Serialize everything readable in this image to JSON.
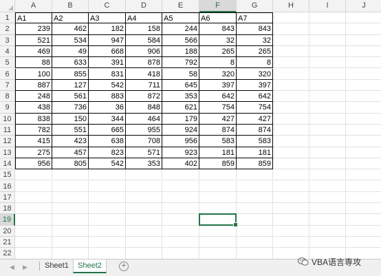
{
  "columns": [
    "A",
    "B",
    "C",
    "D",
    "E",
    "F",
    "G",
    "H",
    "I",
    "J"
  ],
  "rows": [
    "1",
    "2",
    "3",
    "4",
    "5",
    "6",
    "7",
    "8",
    "9",
    "10",
    "11",
    "12",
    "13",
    "14",
    "15",
    "16",
    "17",
    "18",
    "19",
    "20",
    "21",
    "22"
  ],
  "selected": {
    "column": "F",
    "row": "19"
  },
  "table": {
    "headers": [
      "A1",
      "A2",
      "A3",
      "A4",
      "A5",
      "A6",
      "A7"
    ],
    "data": [
      [
        "239",
        "462",
        "182",
        "158",
        "244",
        "843",
        "843"
      ],
      [
        "521",
        "534",
        "947",
        "584",
        "566",
        "32",
        "32"
      ],
      [
        "469",
        "49",
        "668",
        "906",
        "188",
        "265",
        "265"
      ],
      [
        "88",
        "633",
        "391",
        "878",
        "792",
        "8",
        "8"
      ],
      [
        "100",
        "855",
        "831",
        "418",
        "58",
        "320",
        "320"
      ],
      [
        "887",
        "127",
        "542",
        "711",
        "645",
        "397",
        "397"
      ],
      [
        "248",
        "561",
        "883",
        "872",
        "353",
        "642",
        "642"
      ],
      [
        "438",
        "736",
        "36",
        "848",
        "621",
        "754",
        "754"
      ],
      [
        "838",
        "150",
        "344",
        "464",
        "179",
        "427",
        "427"
      ],
      [
        "782",
        "551",
        "665",
        "955",
        "924",
        "874",
        "874"
      ],
      [
        "415",
        "423",
        "638",
        "708",
        "956",
        "583",
        "583"
      ],
      [
        "275",
        "457",
        "823",
        "571",
        "923",
        "181",
        "181"
      ],
      [
        "956",
        "805",
        "542",
        "353",
        "402",
        "859",
        "859"
      ]
    ]
  },
  "sheets": [
    {
      "label": "Sheet1",
      "active": false
    },
    {
      "label": "Sheet2",
      "active": true
    }
  ],
  "add_sheet_label": "+",
  "nav_prev": "◀",
  "nav_next": "▶",
  "watermark": "VBA语言専攻",
  "colors": {
    "accent": "#217346",
    "header_bg": "#f3f3f3",
    "grid_line": "#e1e1e1"
  }
}
